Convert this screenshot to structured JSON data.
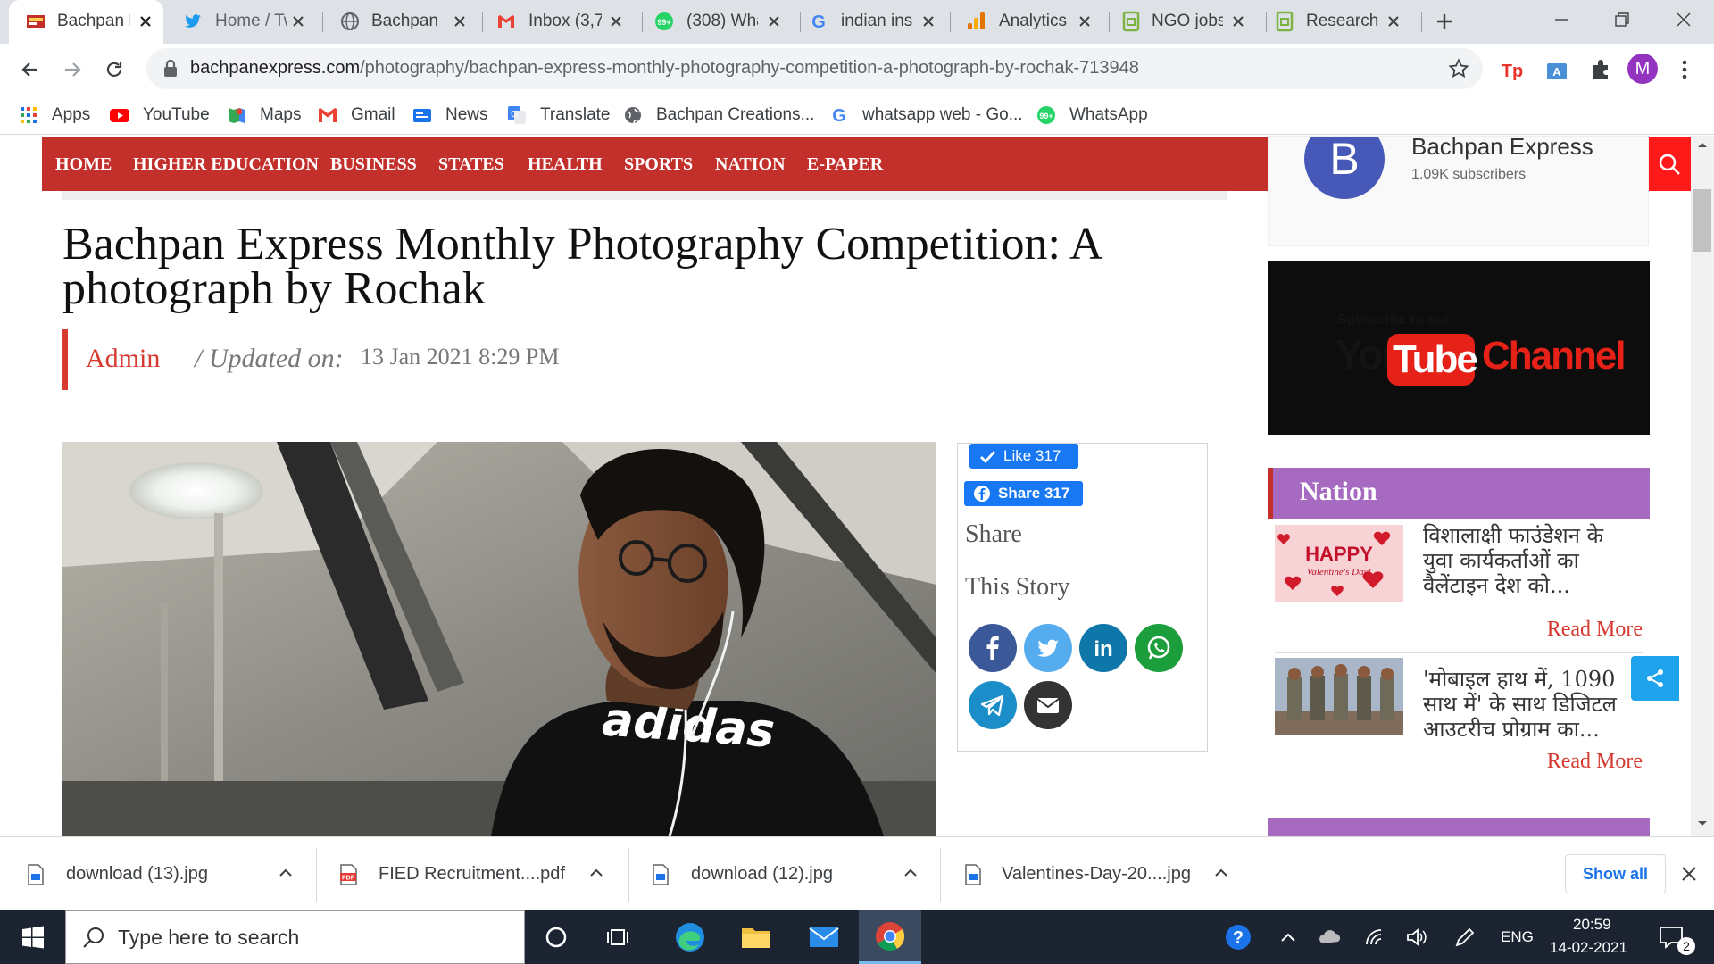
{
  "browser": {
    "tabs": [
      {
        "label": "Bachpan E",
        "active": true
      },
      {
        "label": "Home / Tw"
      },
      {
        "label": "Bachpan C"
      },
      {
        "label": "Inbox (3,7"
      },
      {
        "label": "(308) Wha"
      },
      {
        "label": "indian ins"
      },
      {
        "label": "Analytics"
      },
      {
        "label": "NGO jobs"
      },
      {
        "label": "Research"
      }
    ],
    "new_tab_label": "+",
    "url_host": "bachpanexpress.com",
    "url_path": "/photography/bachpan-express-monthly-photography-competition-a-photograph-by-rochak-713948",
    "profile_initial": "M",
    "bookmarks": [
      {
        "label": "Apps",
        "icon": "apps-grid-icon"
      },
      {
        "label": "YouTube",
        "icon": "youtube-icon"
      },
      {
        "label": "Maps",
        "icon": "maps-icon"
      },
      {
        "label": "Gmail",
        "icon": "gmail-icon"
      },
      {
        "label": "News",
        "icon": "news-icon"
      },
      {
        "label": "Translate",
        "icon": "translate-icon"
      },
      {
        "label": "Bachpan Creations...",
        "icon": "globe-icon"
      },
      {
        "label": "whatsapp web - Go...",
        "icon": "google-icon"
      },
      {
        "label": "WhatsApp",
        "icon": "whatsapp-icon"
      }
    ]
  },
  "site": {
    "nav": [
      "HOME",
      "HIGHER EDUCATION",
      "BUSINESS",
      "STATES",
      "HEALTH",
      "SPORTS",
      "NATION",
      "E-PAPER"
    ],
    "accent_color": "#c32f2b"
  },
  "article": {
    "title": "Bachpan Express Monthly Photography Competition: A photograph by Rochak",
    "author": "Admin",
    "updated_label": "/ Updated on:",
    "updated_date": "13 Jan 2021 8:29 PM",
    "like_label": "Like 317",
    "share_button_label": "Share 317",
    "share_heading_1": "Share",
    "share_heading_2": "This Story",
    "photo_shirt_text": "adidas"
  },
  "sidebar": {
    "channel_name": "Bachpan Express",
    "channel_subscribers": "1.09K subscribers",
    "channel_avatar_letter": "B",
    "banner_small": "Subscribe to our",
    "banner_you": "You",
    "banner_tube": "Tube",
    "banner_channel": "Channel",
    "section_title": "Nation",
    "news": [
      {
        "title": "विशालाक्षी फाउंडेशन के युवा कार्यकर्ताओं का वैलेंटाइन देश को...",
        "read_more": "Read More",
        "thumb_text_1": "HAPPY",
        "thumb_text_2": "Valentine's Day!"
      },
      {
        "title": "'मोबाइल हाथ में, 1090 साथ में' के साथ डिजिटल आउटरीच प्रोग्राम का...",
        "read_more": "Read More"
      }
    ]
  },
  "downloads": [
    {
      "name": "download (13).jpg",
      "icon": "image-file-icon"
    },
    {
      "name": "FIED Recruitment....pdf",
      "icon": "pdf-file-icon"
    },
    {
      "name": "download (12).jpg",
      "icon": "image-file-icon"
    },
    {
      "name": "Valentines-Day-20....jpg",
      "icon": "image-file-icon"
    }
  ],
  "downloads_show_all": "Show all",
  "taskbar": {
    "search_placeholder": "Type here to search",
    "language": "ENG",
    "time": "20:59",
    "date": "14-02-2021",
    "notification_count": "2"
  }
}
